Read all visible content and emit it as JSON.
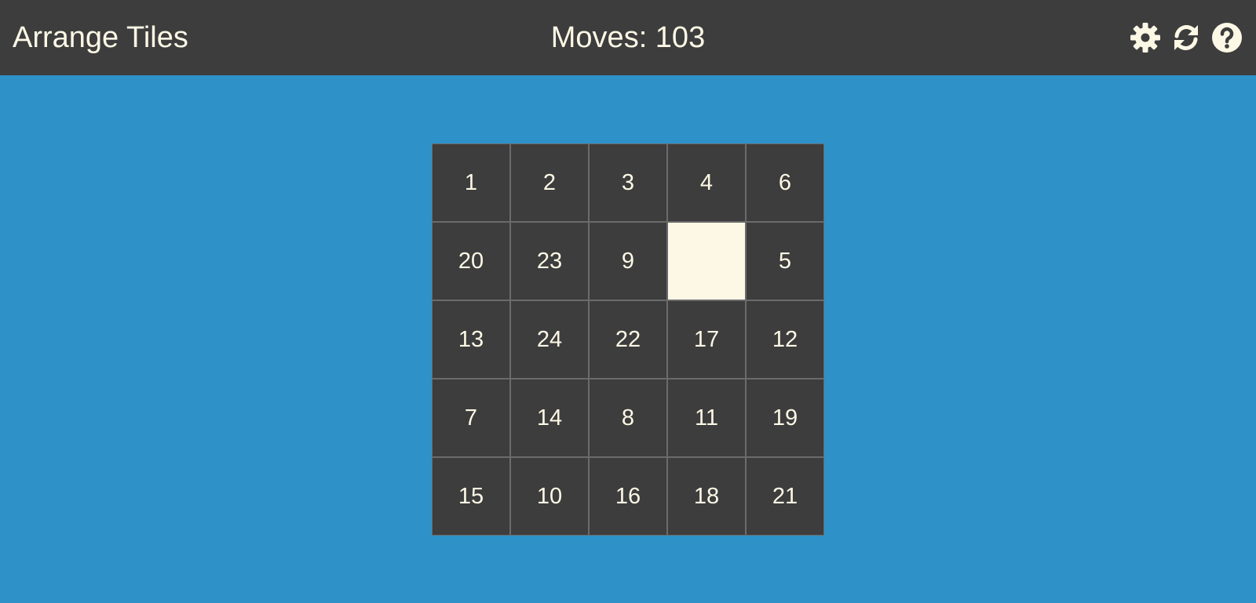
{
  "header": {
    "title": "Arrange Tiles",
    "moves_text": "Moves: 103"
  },
  "toolbar": {
    "buttons": [
      {
        "name": "settings",
        "icon": "gear-icon"
      },
      {
        "name": "restart",
        "icon": "refresh-icon"
      },
      {
        "name": "help",
        "icon": "question-circle-icon"
      }
    ]
  },
  "board": {
    "rows": 5,
    "cols": 5,
    "tiles": [
      "1",
      "2",
      "3",
      "4",
      "6",
      "20",
      "23",
      "9",
      "",
      "5",
      "13",
      "24",
      "22",
      "17",
      "12",
      "7",
      "14",
      "8",
      "11",
      "19",
      "15",
      "10",
      "16",
      "18",
      "21"
    ]
  },
  "colors": {
    "background": "#2e91c8",
    "bar": "#3d3d3d",
    "tile": "#3d3d3d",
    "tile_text": "#fdf8e6",
    "empty_tile": "#fdf8e6"
  }
}
